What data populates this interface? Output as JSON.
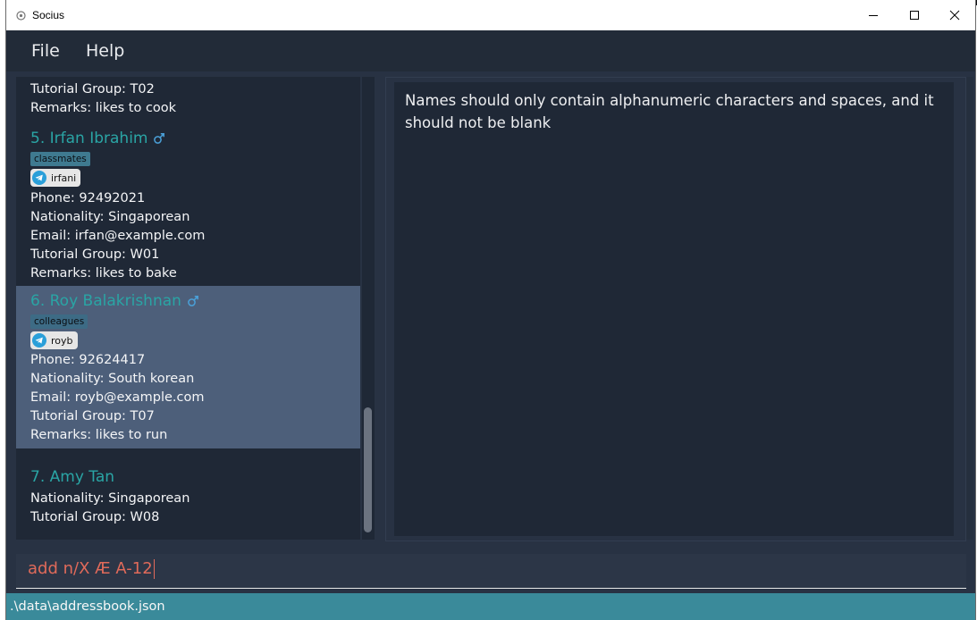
{
  "window": {
    "title": "Socius"
  },
  "menu": {
    "file": "File",
    "help": "Help"
  },
  "persons": [
    {
      "tutorial_group": "Tutorial Group: T02",
      "remarks": "Remarks: likes to cook"
    },
    {
      "name": "5.  Irfan Ibrahim",
      "tag": "classmates",
      "telegram": "irfani",
      "phone": "Phone: 92492021",
      "nationality": "Nationality: Singaporean",
      "email": "Email: irfan@example.com",
      "tutorial_group": "Tutorial Group: W01",
      "remarks": "Remarks: likes to bake",
      "gender_icon": "male-icon"
    },
    {
      "name": "6.  Roy Balakrishnan",
      "tag": "colleagues",
      "telegram": "royb",
      "phone": "Phone: 92624417",
      "nationality": "Nationality: South korean",
      "email": "Email: royb@example.com",
      "tutorial_group": "Tutorial Group: T07",
      "remarks": "Remarks: likes to run",
      "gender_icon": "male-icon",
      "selected": true
    },
    {
      "name": "7.  Amy Tan",
      "nationality": "Nationality: Singaporean",
      "tutorial_group": "Tutorial Group: W08"
    }
  ],
  "result": {
    "message": "Names should only contain alphanumeric characters and spaces, and it should not be blank"
  },
  "command": {
    "value": "add n/X Æ A-12"
  },
  "status": {
    "file_path": ".\\data\\addressbook.json"
  },
  "colors": {
    "name": "#2aa5a5",
    "selected_card": "#4d5f7a",
    "command_error_text": "#e06a5a",
    "status_bar": "#3a8a9a"
  }
}
